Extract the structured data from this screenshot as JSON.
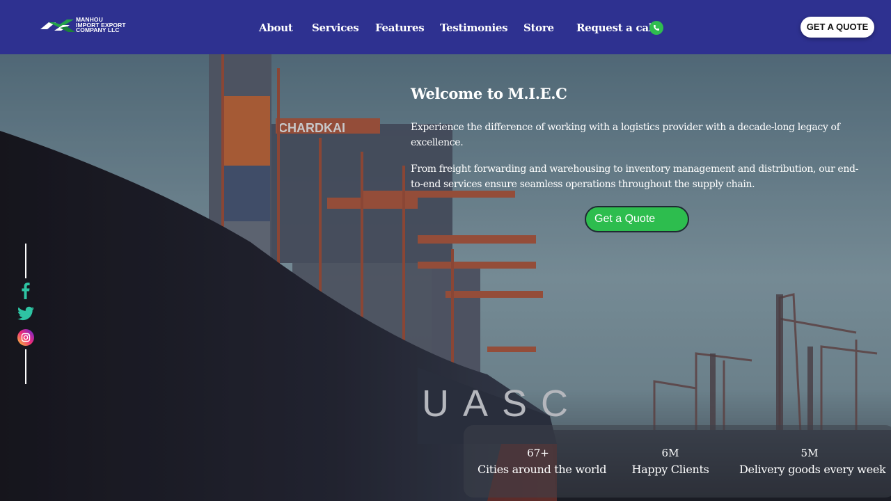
{
  "logo": {
    "lines": [
      "MANHOU",
      "IMPORT EXPORT",
      "COMPANY LLC"
    ]
  },
  "nav": {
    "items": [
      "About",
      "Services",
      "Features",
      "Testimonies",
      "Store",
      "Request a call"
    ],
    "phone_icon": "phone-icon",
    "quote_button": "GET A QUOTE"
  },
  "hero": {
    "title": "Welcome to M.I.E.C",
    "paragraph1": "Experience the difference of working with a logistics provider with a decade-long legacy of excellence.",
    "paragraph2": "From freight forwarding and warehousing to inventory management and distribution, our end-to-end services ensure seamless operations throughout the supply chain.",
    "quote_button": "Get a Quote",
    "ship_text": "UASC",
    "crane_text": "CHARDKAI"
  },
  "social": [
    "facebook-icon",
    "twitter-icon",
    "instagram-icon"
  ],
  "stats": [
    {
      "value": "67+",
      "label": "Cities around the world"
    },
    {
      "value": "6M",
      "label": "Happy Clients"
    },
    {
      "value": "5M",
      "label": "Delivery goods every week"
    }
  ],
  "colors": {
    "header": "#2e3190",
    "accent_green": "#2dbd4e",
    "social_icon": "#2ec4a3"
  }
}
